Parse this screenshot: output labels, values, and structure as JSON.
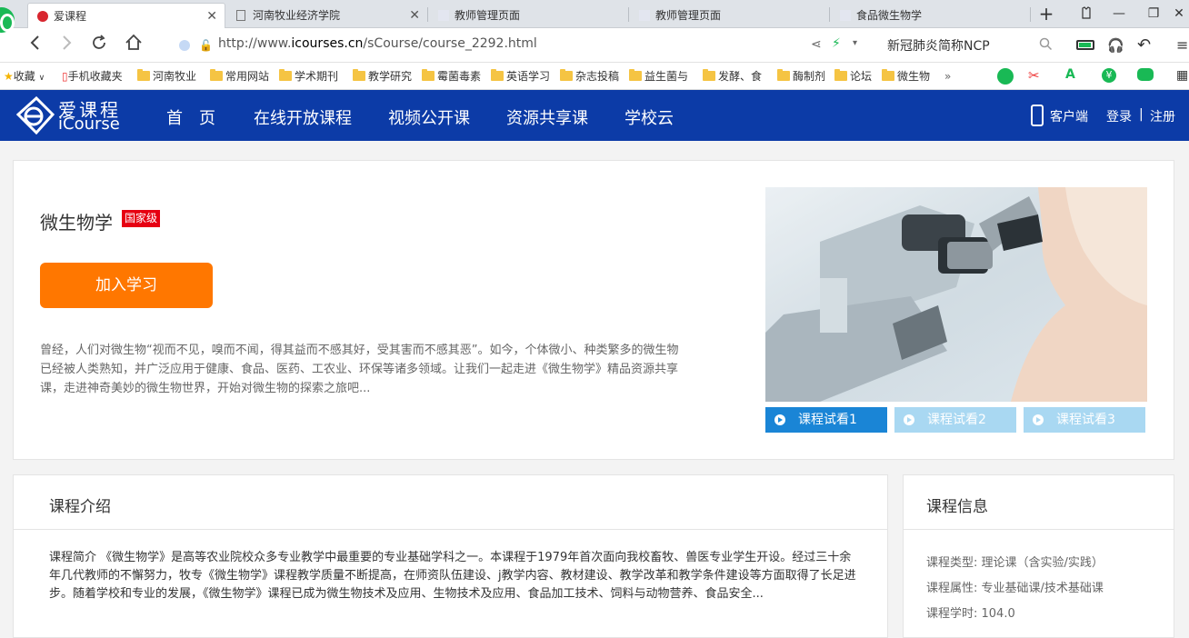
{
  "browser": {
    "tabs": [
      {
        "title": "爱课程",
        "active": true
      },
      {
        "title": "河南牧业经济学院",
        "active": false
      },
      {
        "title": "教师管理页面",
        "active": false
      },
      {
        "title": "教师管理页面",
        "active": false
      },
      {
        "title": "食品微生物学",
        "active": false
      }
    ],
    "url_prefix": "http://www.",
    "url_domain": "icourses.cn",
    "url_path": "/sCourse/course_2292.html",
    "search_text": "新冠肺炎简称NCP",
    "bookmarks": [
      "收藏",
      "手机收藏夹",
      "河南牧业",
      "常用网站",
      "学术期刊",
      "教学研究",
      "霉菌毒素",
      "英语学习",
      "杂志投稿",
      "益生菌与",
      "发酵、食",
      "酶制剂",
      "论坛",
      "微生物"
    ],
    "more": "»"
  },
  "site": {
    "logo_cn": "爱课程",
    "logo_en": "iCourse",
    "nav": [
      "首　页",
      "在线开放课程",
      "视频公开课",
      "资源共享课",
      "学校云"
    ],
    "client_label": "客户端",
    "login": "登录",
    "divider": "|",
    "register": "注册",
    "colors": {
      "header": "#0c3ba7",
      "accent": "#ff7700",
      "badge": "#e60012",
      "trial_active": "#1a85d6",
      "trial_inactive": "#a9d8f2"
    }
  },
  "course": {
    "title": "微生物学",
    "level_badge": "国家级",
    "join_label": "加入学习",
    "description": "曾经，人们对微生物“视而不见，嗅而不闻，得其益而不感其好，受其害而不感其恶”。如今，个体微小、种类繁多的微生物已经被人类熟知，并广泛应用于健康、食品、医药、工农业、环保等诸多领域。让我们一起走进《微生物学》精品资源共享课，走进神奇美妙的微生物世界，开始对微生物的探索之旅吧...",
    "trials": [
      "课程试看1",
      "课程试看2",
      "课程试看3"
    ]
  },
  "intro": {
    "heading": "课程介绍",
    "text": "课程简介 《微生物学》是高等农业院校众多专业教学中最重要的专业基础学科之一。本课程于1979年首次面向我校畜牧、兽医专业学生开设。经过三十余年几代教师的不懈努力，牧专《微生物学》课程教学质量不断提高，在师资队伍建设、j教学内容、教材建设、教学改革和教学条件建设等方面取得了长足进步。随着学校和专业的发展，《微生物学》课程已成为微生物技术及应用、生物技术及应用、食品加工技术、饲料与动物营养、食品安全..."
  },
  "info": {
    "heading": "课程信息",
    "rows": [
      "课程类型: 理论课（含实验/实践）",
      "课程属性: 专业基础课/技术基础课",
      "课程学时: 104.0"
    ]
  }
}
